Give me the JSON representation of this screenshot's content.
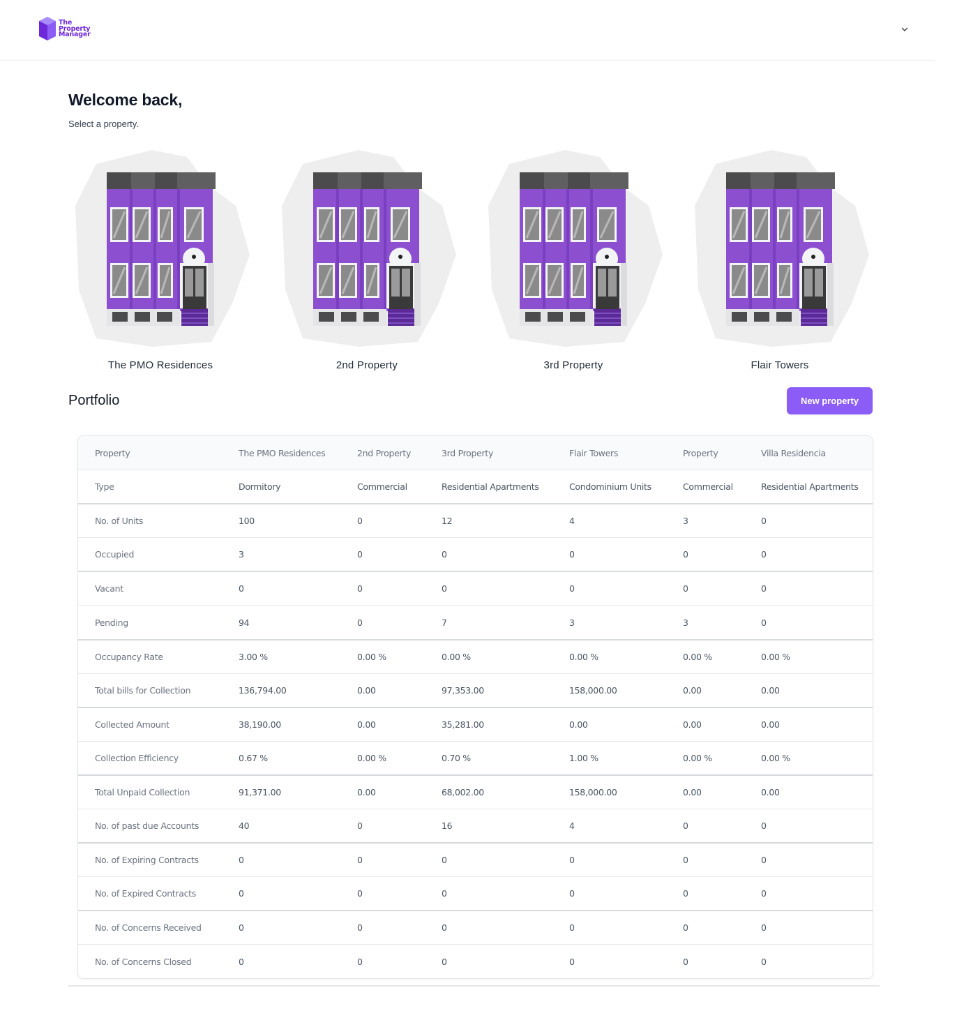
{
  "header": {
    "logo_lines": [
      "The",
      "Property",
      "Manager"
    ],
    "menu_icon": "chevron-down-icon"
  },
  "welcome": {
    "title": "Welcome back,",
    "subtitle": "Select a property."
  },
  "properties": [
    {
      "name": "The PMO Residences",
      "image": "building-illustration"
    },
    {
      "name": "2nd Property",
      "image": "building-illustration"
    },
    {
      "name": "3rd Property",
      "image": "building-illustration"
    },
    {
      "name": "Flair Towers",
      "image": "building-illustration"
    }
  ],
  "portfolio": {
    "title": "Portfolio",
    "new_property_label": "New property",
    "columns": [
      "Property",
      "The PMO Residences",
      "2nd Property",
      "3rd Property",
      "Flair Towers",
      "Property",
      "Villa Residencia"
    ],
    "rows": [
      [
        "Type",
        "Dormitory",
        "Commercial",
        "Residential Apartments",
        "Condominium Units",
        "Commercial",
        "Residential Apartments"
      ],
      [
        "No. of Units",
        "100",
        "0",
        "12",
        "4",
        "3",
        "0"
      ],
      [
        "Occupied",
        "3",
        "0",
        "0",
        "0",
        "0",
        "0"
      ],
      [
        "Vacant",
        "0",
        "0",
        "0",
        "0",
        "0",
        "0"
      ],
      [
        "Pending",
        "94",
        "0",
        "7",
        "3",
        "3",
        "0"
      ],
      [
        "Occupancy Rate",
        "3.00 %",
        "0.00 %",
        "0.00 %",
        "0.00 %",
        "0.00 %",
        "0.00 %"
      ],
      [
        "Total bills for Collection",
        "136,794.00",
        "0.00",
        "97,353.00",
        "158,000.00",
        "0.00",
        "0.00"
      ],
      [
        "Collected Amount",
        "38,190.00",
        "0.00",
        "35,281.00",
        "0.00",
        "0.00",
        "0.00"
      ],
      [
        "Collection Efficiency",
        "0.67 %",
        "0.00 %",
        "0.70 %",
        "1.00 %",
        "0.00 %",
        "0.00 %"
      ],
      [
        "Total Unpaid Collection",
        "91,371.00",
        "0.00",
        "68,002.00",
        "158,000.00",
        "0.00",
        "0.00"
      ],
      [
        "No. of past due Accounts",
        "40",
        "0",
        "16",
        "4",
        "0",
        "0"
      ],
      [
        "No. of Expiring Contracts",
        "0",
        "0",
        "0",
        "0",
        "0",
        "0"
      ],
      [
        "No. of Expired Contracts",
        "0",
        "0",
        "0",
        "0",
        "0",
        "0"
      ],
      [
        "No. of Concerns Received",
        "0",
        "0",
        "0",
        "0",
        "0",
        "0"
      ],
      [
        "No. of Concerns Closed",
        "0",
        "0",
        "0",
        "0",
        "0",
        "0"
      ]
    ]
  },
  "colors": {
    "accent": "#8b5cf6",
    "brand": "#6d28d9",
    "building": "#8b4fd0",
    "building_dark": "#5b2a96"
  }
}
